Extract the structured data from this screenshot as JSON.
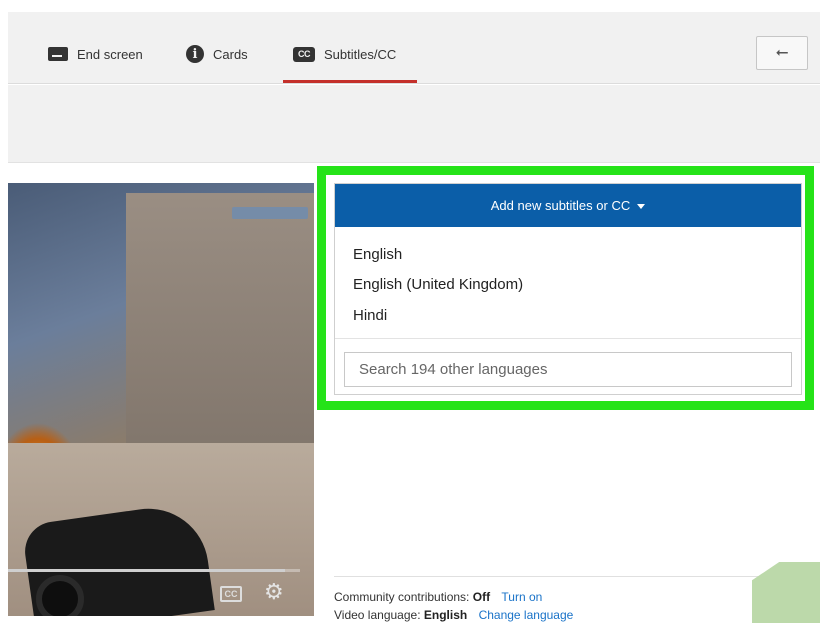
{
  "tabs": [
    {
      "label": "End screen",
      "icon": "end-screen-icon"
    },
    {
      "label": "Cards",
      "icon": "info-icon"
    },
    {
      "label": "Subtitles/CC",
      "icon": "cc-icon",
      "active": true
    }
  ],
  "tab_icons": {
    "info": "i",
    "cc": "CC"
  },
  "back_button": {
    "icon": "back-arrow-icon",
    "glyph": "⭠"
  },
  "video": {
    "progress": 0.95,
    "cc_label": "CC",
    "settings_glyph": "⚙"
  },
  "subtitles_panel": {
    "add_button_label": "Add new subtitles or CC",
    "languages": [
      "English",
      "English (United Kingdom)",
      "Hindi"
    ],
    "search_placeholder": "Search 194 other languages"
  },
  "info": {
    "community_label": "Community contributions:",
    "community_value": "Off",
    "community_link": "Turn on",
    "video_language_label": "Video language:",
    "video_language_value": "English",
    "video_language_link": "Change language"
  },
  "colors": {
    "accent_blue": "#0b5ea8",
    "highlight_green": "#25e318",
    "tab_underline": "#c4302b",
    "link": "#1a73c8"
  }
}
